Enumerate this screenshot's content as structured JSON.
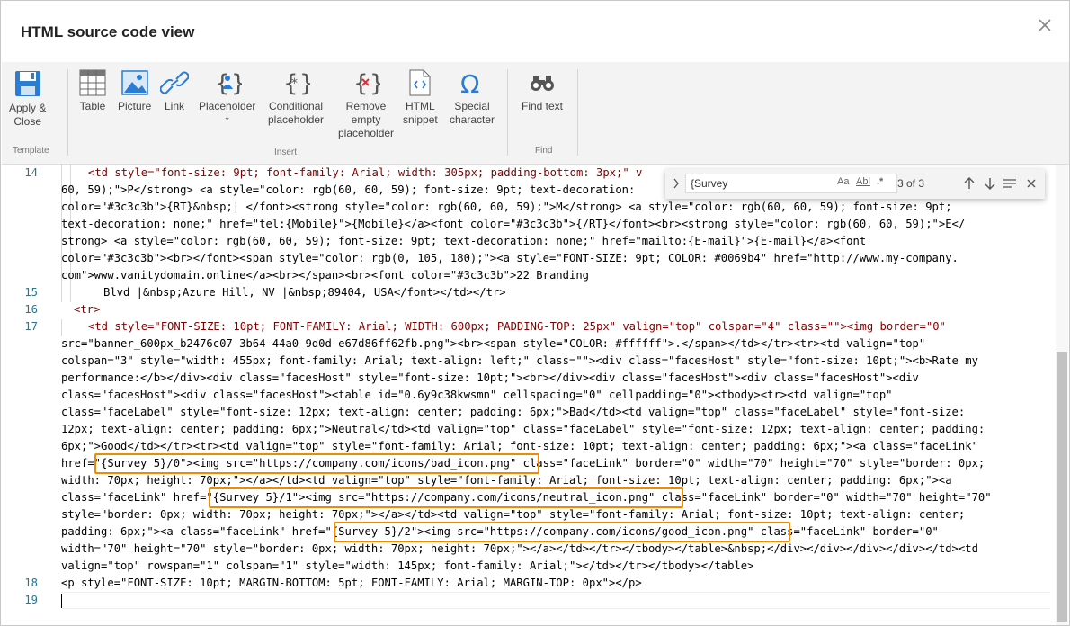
{
  "dialog": {
    "title": "HTML source code view"
  },
  "ribbon": {
    "template": {
      "apply_close": "Apply &",
      "apply_close2": "Close",
      "label": "Template"
    },
    "insert": {
      "table": "Table",
      "picture": "Picture",
      "link": "Link",
      "placeholder": "Placeholder",
      "conditional1": "Conditional",
      "conditional2": "placeholder",
      "remove1": "Remove",
      "remove2": "empty",
      "remove3": "placeholder",
      "snippet1": "HTML",
      "snippet2": "snippet",
      "special1": "Special",
      "special2": "character",
      "label": "Insert"
    },
    "find": {
      "find_text": "Find text",
      "label": "Find"
    }
  },
  "find_widget": {
    "query": "{Survey",
    "match_case": "Aa",
    "whole_word": "Abl",
    "regex": ".*",
    "count": "3 of 3"
  },
  "editor": {
    "line_numbers": [
      "14",
      "15",
      "16",
      "17",
      "18",
      "19"
    ],
    "code": {
      "l14a": "<td style=\"font-size: 9pt; font-family: Arial; width: 305px; padding-bottom: 3px;\" v",
      "l14b": "60, 59);\">P</strong> <a style=\"color: rgb(60, 60, 59); font-size: 9pt; text-decoration:",
      "l14c": "color=\"#3c3c3b\">{RT}&nbsp;| </font><strong style=\"color: rgb(60, 60, 59);\">M</strong> <a style=\"color: rgb(60, 60, 59); font-size: 9pt;",
      "l14d": "text-decoration: none;\" href=\"tel:{Mobile}\">{Mobile}</a><font color=\"#3c3c3b\">{/RT}</font><br><strong style=\"color: rgb(60, 60, 59);\">E</",
      "l14e": "strong> <a style=\"color: rgb(60, 60, 59); font-size: 9pt; text-decoration: none;\" href=\"mailto:{E-mail}\">{E-mail}</a><font",
      "l14f": "color=\"#3c3c3b\"><br></font><span style=\"color: rgb(0, 105, 180);\"><a style=\"FONT-SIZE: 9pt; COLOR: #0069b4\" href=\"http://www.my-company.",
      "l14g": "com\">www.vanitydomain.online</a><br></span><br><font color=\"#3c3c3b\">22 Branding",
      "l15": "Blvd |&nbsp;Azure Hill, NV |&nbsp;89404, USA</font></td></tr>",
      "l16": "<tr>",
      "l17a": "<td style=\"FONT-SIZE: 10pt; FONT-FAMILY: Arial; WIDTH: 600px; PADDING-TOP: 25px\" valign=\"top\" colspan=\"4\" class=\"\"><img border=\"0\"",
      "l17b": "src=\"banner_600px_b2476c07-3b64-44a0-9d0d-e67d86ff62fb.png\"><br><span style=\"COLOR: #ffffff\">.</span></td></tr><tr><td valign=\"top\"",
      "l17c": "colspan=\"3\" style=\"width: 455px; font-family: Arial; text-align: left;\" class=\"\"><div class=\"facesHost\" style=\"font-size: 10pt;\"><b>Rate my",
      "l17d": "performance:</b></div><div class=\"facesHost\" style=\"font-size: 10pt;\"><br></div><div class=\"facesHost\"><div class=\"facesHost\"><div",
      "l17e": "class=\"facesHost\"><div class=\"facesHost\"><table id=\"0.6y9c38kwsmn\" cellspacing=\"0\" cellpadding=\"0\"><tbody><tr><td valign=\"top\"",
      "l17f": "class=\"faceLabel\" style=\"font-size: 12px; text-align: center; padding: 6px;\">Bad</td><td valign=\"top\" class=\"faceLabel\" style=\"font-size:",
      "l17g": "12px; text-align: center; padding: 6px;\">Neutral</td><td valign=\"top\" class=\"faceLabel\" style=\"font-size: 12px; text-align: center; padding:",
      "l17h": "6px;\">Good</td></tr><tr><td valign=\"top\" style=\"font-family: Arial; font-size: 10pt; text-align: center; padding: 6px;\"><a class=\"faceLink\"",
      "l17i": "href=\"{Survey 5}/0\"><img src=\"https://company.com/icons/bad_icon.png\" class=\"faceLink\" border=\"0\" width=\"70\" height=\"70\" style=\"border: 0px;",
      "l17j": "width: 70px; height: 70px;\"></a></td><td valign=\"top\" style=\"font-family: Arial; font-size: 10pt; text-align: center; padding: 6px;\"><a",
      "l17k": "class=\"faceLink\" href=\"{Survey 5}/1\"><img src=\"https://company.com/icons/neutral_icon.png\" class=\"faceLink\" border=\"0\" width=\"70\" height=\"70\"",
      "l17l": "style=\"border: 0px; width: 70px; height: 70px;\"></a></td><td valign=\"top\" style=\"font-family: Arial; font-size: 10pt; text-align: center;",
      "l17m": "padding: 6px;\"><a class=\"faceLink\" href=\"{Survey 5}/2\"><img src=\"https://company.com/icons/good_icon.png\" class=\"faceLink\" border=\"0\"",
      "l17n": "width=\"70\" height=\"70\" style=\"border: 0px; width: 70px; height: 70px;\"></a></td></tr></tbody></table>&nbsp;</div></div></div></div></td><td",
      "l17o": "valign=\"top\" rowspan=\"1\" colspan=\"1\" style=\"width: 145px; font-family: Arial;\"></td></tr></tbody></table>",
      "l18": "<p style=\"FONT-SIZE: 10pt; MARGIN-BOTTOM: 5pt; FONT-FAMILY: Arial; MARGIN-TOP: 0px\"></p>",
      "l19": ""
    }
  }
}
